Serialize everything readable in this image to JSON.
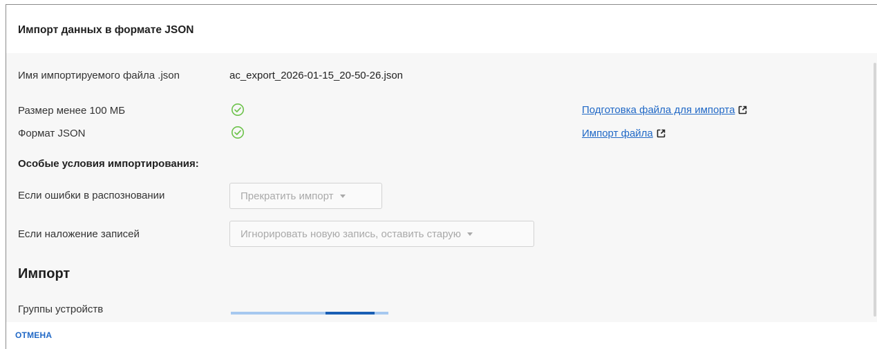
{
  "dialog": {
    "title": "Импорт данных в формате JSON"
  },
  "file": {
    "name_label": "Имя импортируемого файла .json",
    "name_value": "ac_export_2026-01-15_20-50-26.json"
  },
  "checks": [
    {
      "label": "Размер менее 100 МБ",
      "status": "ok",
      "icon": "check-circle-icon"
    },
    {
      "label": "Формат JSON",
      "status": "ok",
      "icon": "check-circle-icon"
    }
  ],
  "links": [
    {
      "label": "Подготовка файла для импорта",
      "icon": "external-link-icon"
    },
    {
      "label": "Импорт файла",
      "icon": "external-link-icon"
    }
  ],
  "conditions": {
    "title": "Особые условия импортирования:",
    "errors_label": "Если ошибки в распознoвании",
    "errors_value": "Прекратить импорт",
    "overlap_label": "Если наложение записей",
    "overlap_value": "Игнорировать новую запись, оставить старую"
  },
  "import": {
    "title": "Импорт",
    "items": [
      {
        "label": "Группы устройств",
        "progress_segment_start": 0.6,
        "progress_segment_end": 0.91
      }
    ]
  },
  "footer": {
    "cancel_label": "ОТМЕНА"
  },
  "colors": {
    "accent": "#2068c6",
    "success": "#6cc24a",
    "progress_track": "#a6c8ef",
    "progress_fill": "#1a5fb4"
  }
}
